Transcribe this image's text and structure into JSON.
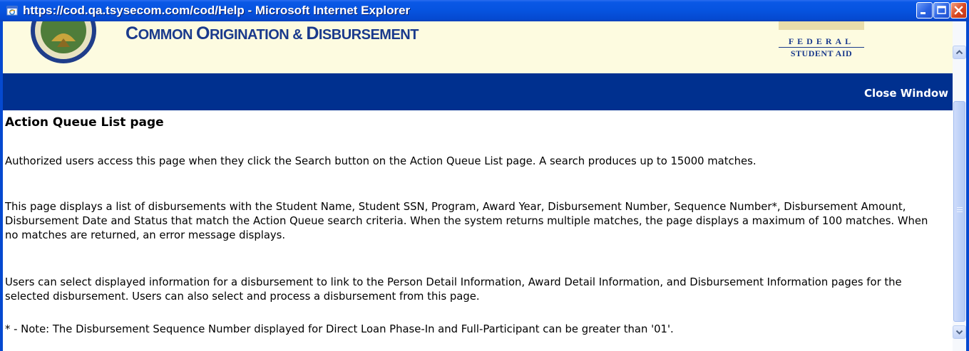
{
  "window": {
    "title": "https://cod.qa.tsysecom.com/cod/Help - Microsoft Internet Explorer",
    "icon": "ie-icon",
    "buttons": [
      "minimize",
      "maximize",
      "close"
    ]
  },
  "banner": {
    "title_big_1": "C",
    "title_small_1": "OMMON ",
    "title_big_2": "O",
    "title_small_2": "RIGINATION & ",
    "title_big_3": "D",
    "title_small_3": "ISBURSEMENT",
    "logo_line1": "FEDERAL",
    "logo_line2": "STUDENT AID"
  },
  "nav": {
    "close_window": "Close Window"
  },
  "content": {
    "heading": "Action Queue List page",
    "paragraph1": "Authorized users access this page when they click the Search button on the Action Queue List page. A search produces up to 15000 matches.",
    "paragraph2": "This page displays a list of disbursements with the Student Name, Student SSN, Program, Award Year, Disbursement Number, Sequence Number*, Disbursement Amount, Disbursement Date and Status that match the Action Queue search criteria. When the system returns multiple matches, the page displays a maximum of 100 matches. When no matches are returned, an error message displays.",
    "paragraph3": "Users can select displayed information for a disbursement to link to the Person Detail Information, Award Detail Information, and Disbursement Information pages for the selected disbursement. Users can also select and process a disbursement from this page.",
    "note": "* - Note: The Disbursement Sequence Number displayed for Direct Loan Phase-In and Full-Participant can be greater than '01'."
  },
  "colors": {
    "titlebar": "#0653df",
    "navbar": "#00308f",
    "banner_bg": "#fdfbe0",
    "banner_text": "#1a3a8c"
  }
}
